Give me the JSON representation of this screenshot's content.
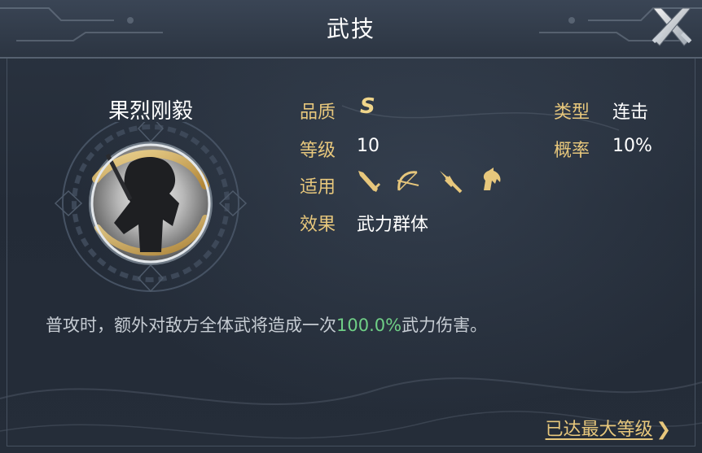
{
  "header": {
    "title": "武技",
    "close_icon": "close-crossed-swords-icon"
  },
  "skill": {
    "name": "果烈刚毅",
    "portrait": "warrior-portrait"
  },
  "attributes": {
    "quality_label": "品质",
    "quality_value": "S",
    "level_label": "等级",
    "level_value": "10",
    "applicable_label": "适用",
    "applicable_icons": [
      "sword-icon",
      "bow-icon",
      "spear-icon",
      "horse-icon"
    ],
    "effect_label": "效果",
    "effect_value": "武力群体",
    "type_label": "类型",
    "type_value": "连击",
    "chance_label": "概率",
    "chance_value": "10%"
  },
  "description": {
    "prefix": "普攻时，额外对敌方全体武将造成一次",
    "highlight": "100.0%",
    "suffix": "武力伤害。"
  },
  "footer": {
    "max_level_label": "已达最大等级",
    "chevron": "❯"
  },
  "colors": {
    "label_gold": "#e7c77c",
    "highlight_green": "#6fcf86",
    "text_white": "#ffffff",
    "desc_gray": "#c6ccd3"
  }
}
